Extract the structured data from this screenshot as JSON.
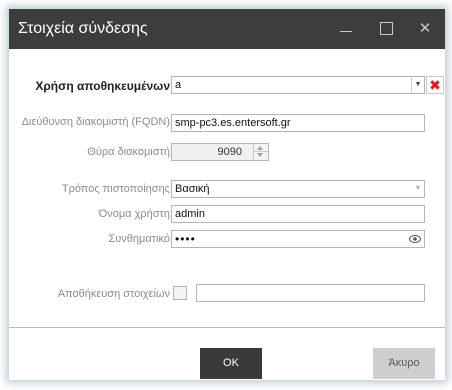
{
  "window": {
    "title": "Στοιχεία σύνδεσης",
    "minimize_icon": "minimize-icon",
    "maximize_icon": "maximize-icon",
    "close_label": "✕"
  },
  "form": {
    "saved_connection": {
      "label": "Χρήση αποθηκευμένων",
      "value": "a"
    },
    "delete_icon": "✖",
    "server_address": {
      "label": "Διεύθυνση διακομιστή (FQDN)",
      "value": "smp-pc3.es.entersoft.gr"
    },
    "server_port": {
      "label": "Θύρα διακομιστή",
      "value": "9090"
    },
    "auth_method": {
      "label": "Τρόπος πιστοποίησης",
      "value": "Βασική"
    },
    "username": {
      "label": "Όνομα χρήστη",
      "value": "admin"
    },
    "password": {
      "label": "Συνθηματικό",
      "value": "••••"
    },
    "save_credentials": {
      "label": "Αποθήκευση στοιχείων",
      "value": ""
    }
  },
  "buttons": {
    "ok": "OK",
    "cancel": "Άκυρο"
  },
  "colors": {
    "title_bar": "#3d3d3d",
    "ok_button": "#3a3a3a",
    "delete": "#e8141b",
    "separator": "#9fc3e4"
  }
}
